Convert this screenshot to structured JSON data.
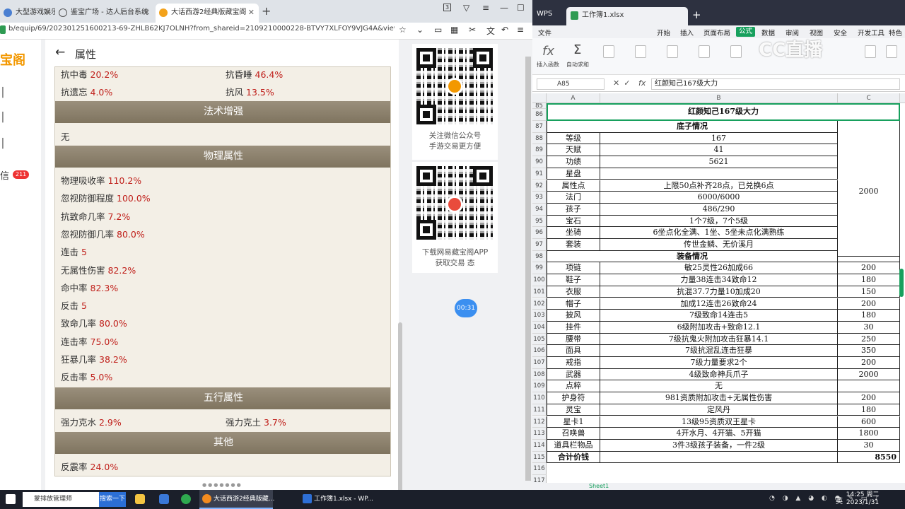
{
  "browser": {
    "tabs": [
      {
        "label": "大型游戏娱乐",
        "icon": "tab-icon-1"
      },
      {
        "label": "鉴宝广场 - 达人后台系统",
        "icon": "globe-icon"
      },
      {
        "label": "大话西游2经典版藏宝阁",
        "icon": "cbg-icon"
      }
    ],
    "tab_count": "3",
    "url": "b/equip/69/202301251600213-69-ZHLB62KJ7OLNH?from_shareid=2109210000228-BTVY7XLFOY9VJG4A&view_loc=link_h5",
    "sidebar": {
      "logo": "宝阁",
      "messages_label": "信",
      "messages_badge": "211"
    },
    "page_title": "属性",
    "sections": {
      "spell": "法术增强",
      "physical": "物理属性",
      "five_elements": "五行属性",
      "other": "其他"
    },
    "resist_items": [
      {
        "label": "抗中毒",
        "value": "20.2%"
      },
      {
        "label": "抗昏睡",
        "value": "46.4%"
      },
      {
        "label": "抗遗忘",
        "value": "4.0%"
      },
      {
        "label": "抗风",
        "value": "13.5%"
      }
    ],
    "spell_none": "无",
    "physical_items": [
      {
        "label": "物理吸收率",
        "value": "110.2%"
      },
      {
        "label": "忽视防御程度",
        "value": "100.0%"
      },
      {
        "label": "抗致命几率",
        "value": "7.2%"
      },
      {
        "label": "忽视防御几率",
        "value": "80.0%"
      },
      {
        "label": "连击",
        "value": "5"
      },
      {
        "label": "无属性伤害",
        "value": "82.2%"
      },
      {
        "label": "命中率",
        "value": "82.3%"
      },
      {
        "label": "反击",
        "value": "5"
      },
      {
        "label": "致命几率",
        "value": "80.0%"
      },
      {
        "label": "连击率",
        "value": "75.0%"
      },
      {
        "label": "狂暴几率",
        "value": "38.2%"
      },
      {
        "label": "反击率",
        "value": "5.0%"
      }
    ],
    "element_items": [
      {
        "label": "强力克水",
        "value": "2.9%"
      },
      {
        "label": "强力克土",
        "value": "3.7%"
      }
    ],
    "other_items": [
      {
        "label": "反震率",
        "value": "24.0%"
      }
    ],
    "qr1_text": [
      "关注微信公众号",
      "手游交易更方便"
    ],
    "qr2_text": [
      "下载网易藏宝阁APP",
      "获取交易 态"
    ],
    "timer": "00:31"
  },
  "wps": {
    "app_tab": "WPS",
    "file_tab": "工作簿1.xlsx",
    "menu": [
      "文件",
      "开始",
      "插入",
      "页面布局",
      "公式",
      "数据",
      "审阅",
      "视图",
      "安全",
      "开发工具",
      "特色"
    ],
    "active_menu": "公式",
    "ribbon": [
      "插入函数",
      "自动求和"
    ],
    "watermark": "CC直播",
    "name_box": "A85",
    "formula": "红颜知己167级大力",
    "columns": [
      "A",
      "B",
      "C"
    ],
    "title_row": "红颜知己167级大力",
    "base_header": "底子情况",
    "equip_header": "装备情况",
    "base_rows": [
      {
        "row": "88",
        "a": "等级",
        "b": "167"
      },
      {
        "row": "89",
        "a": "天赋",
        "b": "41"
      },
      {
        "row": "90",
        "a": "功绩",
        "b": "5621"
      },
      {
        "row": "91",
        "a": "星盘",
        "b": ""
      },
      {
        "row": "92",
        "a": "属性点",
        "b": "上限50点补齐28点，已兑换6点"
      },
      {
        "row": "93",
        "a": "法门",
        "b": "6000/6000"
      },
      {
        "row": "94",
        "a": "孩子",
        "b": "486/290"
      },
      {
        "row": "95",
        "a": "宝石",
        "b": "1个7级，7个5级"
      },
      {
        "row": "96",
        "a": "坐骑",
        "b": "6坐点化全满、1坐、5坐未点化满熟练"
      },
      {
        "row": "97",
        "a": "套装",
        "b": "传世金鳞、无价溪月"
      }
    ],
    "base_price": "2000",
    "equip_rows": [
      {
        "row": "99",
        "a": "项链",
        "b": "敏25灵性26加成66",
        "c": "200"
      },
      {
        "row": "100",
        "a": "鞋子",
        "b": "力量38连击34致命12",
        "c": "180"
      },
      {
        "row": "101",
        "a": "衣服",
        "b": "抗混37.7力量10加成20",
        "c": "150"
      },
      {
        "row": "102",
        "a": "帽子",
        "b": "加成12连击26致命24",
        "c": "200"
      },
      {
        "row": "103",
        "a": "披风",
        "b": "7级致命14连击5",
        "c": "180"
      },
      {
        "row": "104",
        "a": "挂件",
        "b": "6级附加攻击+致命12.1",
        "c": "30"
      },
      {
        "row": "105",
        "a": "腰带",
        "b": "7级抗鬼火附加攻击狂暴14.1",
        "c": "250"
      },
      {
        "row": "106",
        "a": "面具",
        "b": "7级抗混乱连击狂暴",
        "c": "350"
      },
      {
        "row": "107",
        "a": "戒指",
        "b": "7级力量要求2个",
        "c": "200"
      },
      {
        "row": "108",
        "a": "武器",
        "b": "4级致命神兵爪子",
        "c": "2000"
      },
      {
        "row": "109",
        "a": "点粹",
        "b": "无",
        "c": ""
      },
      {
        "row": "110",
        "a": "护身符",
        "b": "981资质附加攻击+无属性伤害",
        "c": "200"
      },
      {
        "row": "111",
        "a": "灵宝",
        "b": "定风丹",
        "c": "180"
      },
      {
        "row": "112",
        "a": "星卡1",
        "b": "13级95资质双王星卡",
        "c": "600"
      },
      {
        "row": "113",
        "a": "召唤兽",
        "b": "4开水月、4开猫、5开猫",
        "c": "1800"
      },
      {
        "row": "114",
        "a": "道具栏物品",
        "b": "3件3级孩子装备，一件2级",
        "c": "30"
      }
    ],
    "total_row": {
      "row": "115",
      "a": "合计价钱",
      "c": "8550"
    },
    "row_numbers": [
      "85",
      "86",
      "87",
      "98",
      "116",
      "117",
      "118"
    ],
    "sheet_tab": "Sheet1"
  },
  "taskbar": {
    "search_placeholder": "蒙排放管理师",
    "search_button": "搜索一下",
    "apps": [
      "大话西游2经典版藏...",
      "工作簿1.xlsx - WP..."
    ],
    "ime": "英",
    "time": "14:25 周二",
    "date": "2023/1/31"
  }
}
